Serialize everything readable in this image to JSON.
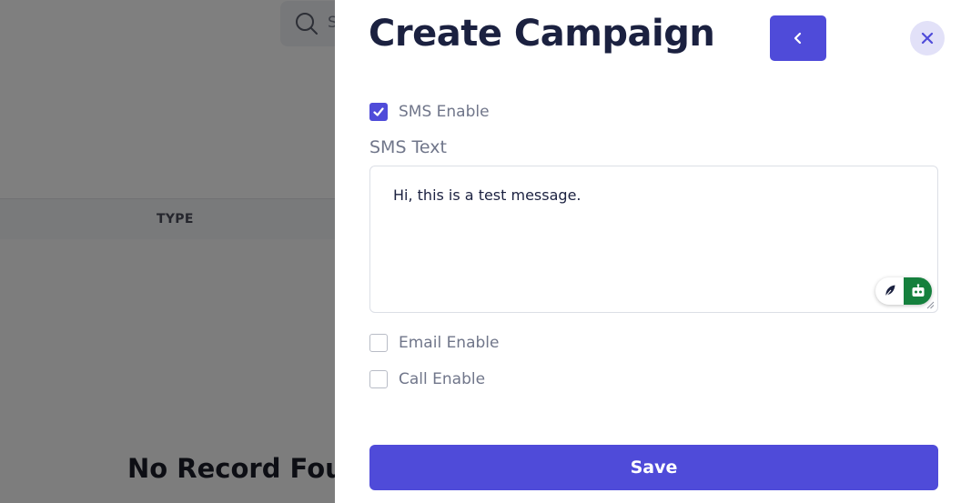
{
  "background": {
    "search": {
      "placeholder_partial": "S"
    },
    "table": {
      "type_header": "TYPE"
    },
    "empty_state": "No Record Foun"
  },
  "drawer": {
    "title": "Create Campaign",
    "back_button": {
      "icon": "chevron-left-icon"
    },
    "close_button": {
      "icon": "close-icon"
    },
    "sms_enable": {
      "label": "SMS Enable",
      "checked": true
    },
    "sms_text": {
      "label": "SMS Text",
      "value": "Hi, this is a test message."
    },
    "email_enable": {
      "label": "Email Enable",
      "checked": false
    },
    "call_enable": {
      "label": "Call Enable",
      "checked": false
    },
    "save_label": "Save"
  },
  "colors": {
    "primary": "#4f4bd9",
    "close_bg": "#e2e1f8",
    "title": "#1b2140",
    "label": "#70768a",
    "bot_green": "#15803d"
  }
}
